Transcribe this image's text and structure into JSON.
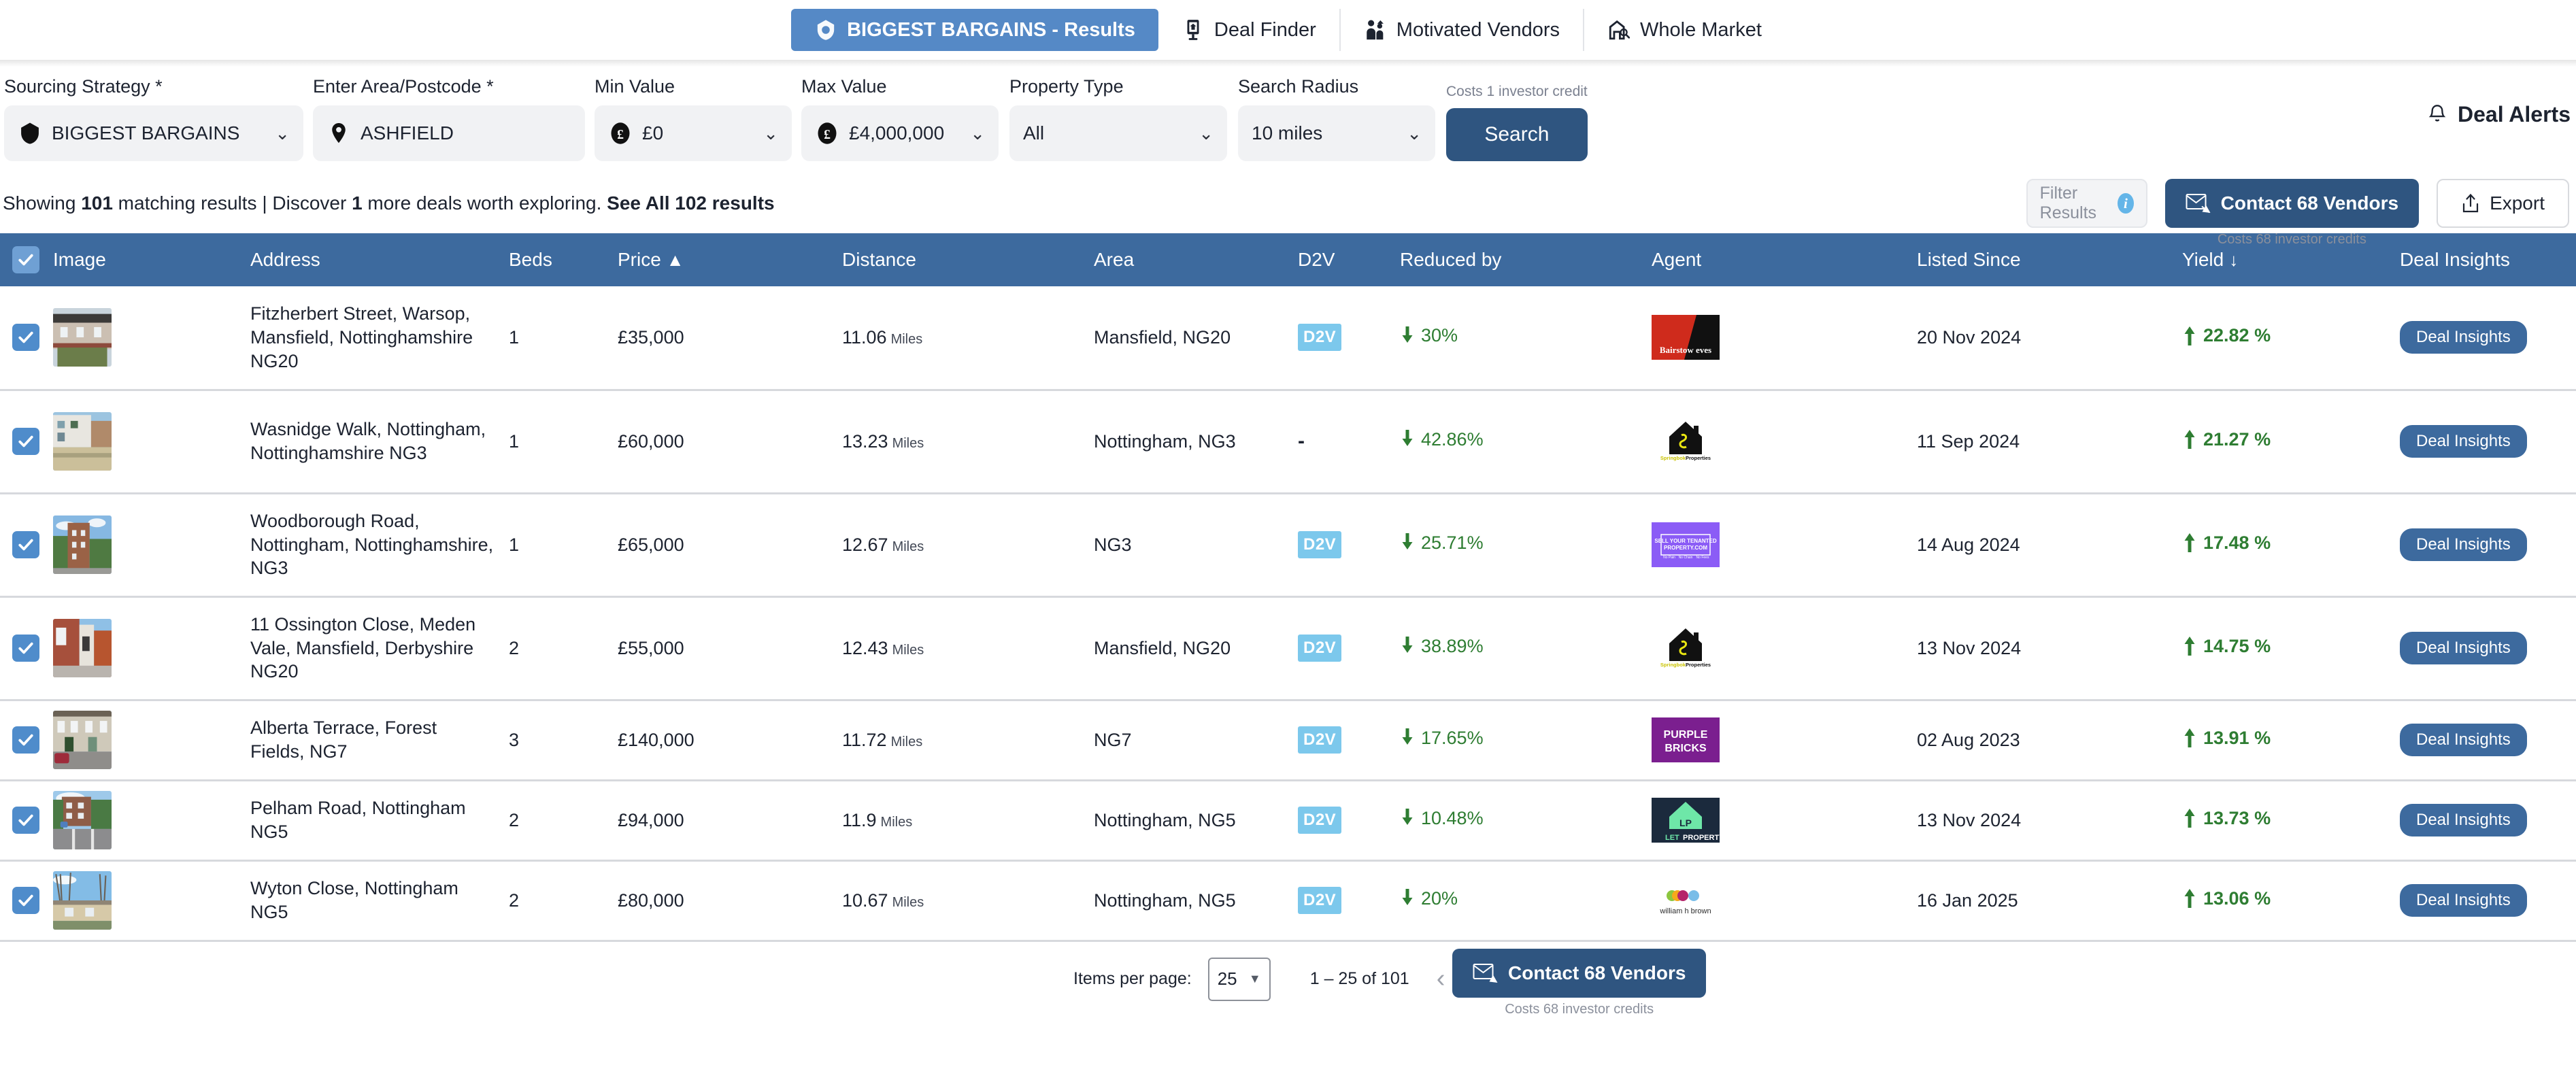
{
  "nav": {
    "tabs": [
      {
        "label": "BIGGEST BARGAINS - Results",
        "icon": "bargain-tag-icon",
        "active": true
      },
      {
        "label": "Deal Finder",
        "icon": "deal-finder-icon",
        "active": false
      },
      {
        "label": "Motivated Vendors",
        "icon": "motivated-vendors-icon",
        "active": false
      },
      {
        "label": "Whole Market",
        "icon": "whole-market-icon",
        "active": false
      }
    ]
  },
  "filters": {
    "sourcing_strategy": {
      "label": "Sourcing Strategy *",
      "value": "BIGGEST BARGAINS",
      "icon": "bargain-tag-icon"
    },
    "area": {
      "label": "Enter Area/Postcode *",
      "value": "ASHFIELD",
      "placeholder": "Enter Area/Postcode",
      "icon": "location-pin-icon"
    },
    "min_value": {
      "label": "Min Value",
      "value": "£0",
      "icon": "pound-coin-icon"
    },
    "max_value": {
      "label": "Max Value",
      "value": "£4,000,000",
      "icon": "pound-coin-icon"
    },
    "property_type": {
      "label": "Property Type",
      "value": "All"
    },
    "search_radius": {
      "label": "Search Radius",
      "value": "10 miles"
    },
    "search_button": "Search",
    "credit_note": "Costs 1 investor credit",
    "deal_alerts": "Deal Alerts"
  },
  "summary": {
    "prefix": "Showing ",
    "count": "101",
    "mid": " matching results | Discover ",
    "extra": "1",
    "suffix": " more deals worth exploring. ",
    "link": "See All 102 results",
    "filter_results_placeholder": "Filter Results",
    "contact_vendors": "Contact 68 Vendors",
    "contact_vendors_sub": "Costs 68 investor credits",
    "export": "Export"
  },
  "table": {
    "columns": [
      {
        "key": "check",
        "label": ""
      },
      {
        "key": "image",
        "label": "Image"
      },
      {
        "key": "address",
        "label": "Address"
      },
      {
        "key": "beds",
        "label": "Beds"
      },
      {
        "key": "price",
        "label": "Price",
        "sort": "▲"
      },
      {
        "key": "distance",
        "label": "Distance"
      },
      {
        "key": "area",
        "label": "Area"
      },
      {
        "key": "d2v",
        "label": "D2V"
      },
      {
        "key": "reduced_by",
        "label": "Reduced by"
      },
      {
        "key": "agent",
        "label": "Agent"
      },
      {
        "key": "listed_since",
        "label": "Listed Since"
      },
      {
        "key": "yield",
        "label": "Yield",
        "sort": "↓"
      },
      {
        "key": "deal_insights",
        "label": "Deal Insights"
      }
    ],
    "insights_label": "Deal Insights",
    "rows": [
      {
        "checked": true,
        "thumb": "terraced-house-rear-thumb",
        "address": "Fitzherbert Street, Warsop, Mansfield, Nottinghamshire NG20",
        "beds": "1",
        "price": "£35,000",
        "distance": "11.06",
        "distance_unit": "Miles",
        "area": "Mansfield, NG20",
        "d2v": "D2V",
        "reduced_by": "30%",
        "agent": "Bairstow eves",
        "agent_logo": "bairstow-eves-logo",
        "listed_since": "20 Nov 2024",
        "yield": "22.82 %"
      },
      {
        "checked": true,
        "thumb": "white-flats-thumb",
        "address": "Wasnidge Walk, Nottingham, Nottinghamshire NG3",
        "beds": "1",
        "price": "£60,000",
        "distance": "13.23",
        "distance_unit": "Miles",
        "area": "Nottingham, NG3",
        "d2v": "-",
        "reduced_by": "42.86%",
        "agent": "Springbok Properties",
        "agent_logo": "springbok-properties-logo",
        "listed_since": "11 Sep 2024",
        "yield": "21.27 %"
      },
      {
        "checked": true,
        "thumb": "brick-tower-block-thumb",
        "address": "Woodborough Road, Nottingham, Nottinghamshire, NG3",
        "beds": "1",
        "price": "£65,000",
        "distance": "12.67",
        "distance_unit": "Miles",
        "area": "NG3",
        "d2v": "D2V",
        "reduced_by": "25.71%",
        "agent": "Sell Your Tenanted Property.com",
        "agent_logo": "sell-your-tenanted-property-logo",
        "listed_since": "14 Aug 2024",
        "yield": "17.48 %"
      },
      {
        "checked": true,
        "thumb": "red-brick-terrace-thumb",
        "address": "11 Ossington Close, Meden Vale, Mansfield, Derbyshire NG20",
        "beds": "2",
        "price": "£55,000",
        "distance": "12.43",
        "distance_unit": "Miles",
        "area": "Mansfield, NG20",
        "d2v": "D2V",
        "reduced_by": "38.89%",
        "agent": "Springbok Properties",
        "agent_logo": "springbok-properties-logo",
        "listed_since": "13 Nov 2024",
        "yield": "14.75 %"
      },
      {
        "checked": true,
        "thumb": "victorian-terrace-thumb",
        "address": "Alberta Terrace, Forest Fields, NG7",
        "beds": "3",
        "price": "£140,000",
        "distance": "11.72",
        "distance_unit": "Miles",
        "area": "NG7",
        "d2v": "D2V",
        "reduced_by": "17.65%",
        "agent": "PURPLE BRICKS",
        "agent_logo": "purplebricks-logo",
        "listed_since": "02 Aug 2023",
        "yield": "13.91 %"
      },
      {
        "checked": true,
        "thumb": "apartment-block-drive-thumb",
        "address": "Pelham Road, Nottingham NG5",
        "beds": "2",
        "price": "£94,000",
        "distance": "11.9",
        "distance_unit": "Miles",
        "area": "Nottingham, NG5",
        "d2v": "D2V",
        "reduced_by": "10.48%",
        "agent": "LETPROPERTY",
        "agent_logo": "letproperty-logo",
        "listed_since": "13 Nov 2024",
        "yield": "13.73 %"
      },
      {
        "checked": true,
        "thumb": "winter-bungalow-thumb",
        "address": "Wyton Close, Nottingham NG5",
        "beds": "2",
        "price": "£80,000",
        "distance": "10.67",
        "distance_unit": "Miles",
        "area": "Nottingham, NG5",
        "d2v": "D2V",
        "reduced_by": "20%",
        "agent": "william h brown",
        "agent_logo": "william-h-brown-logo",
        "listed_since": "16 Jan 2025",
        "yield": "13.06 %"
      }
    ]
  },
  "paginator": {
    "items_per_page_label": "Items per page:",
    "items_per_page_value": "25",
    "range": "1 – 25 of 101",
    "prev": "‹",
    "next": "›",
    "contact_vendors": "Contact 68 Vendors",
    "contact_vendors_sub": "Costs 68 investor credits"
  },
  "colors": {
    "nav_active": "#5589c6",
    "table_header": "#3d6a9e",
    "primary_dark": "#2f5580",
    "d2v_badge": "#7cc8ec",
    "positive_green": "#2e7d32",
    "checkbox_blue": "#4f8ccb"
  }
}
